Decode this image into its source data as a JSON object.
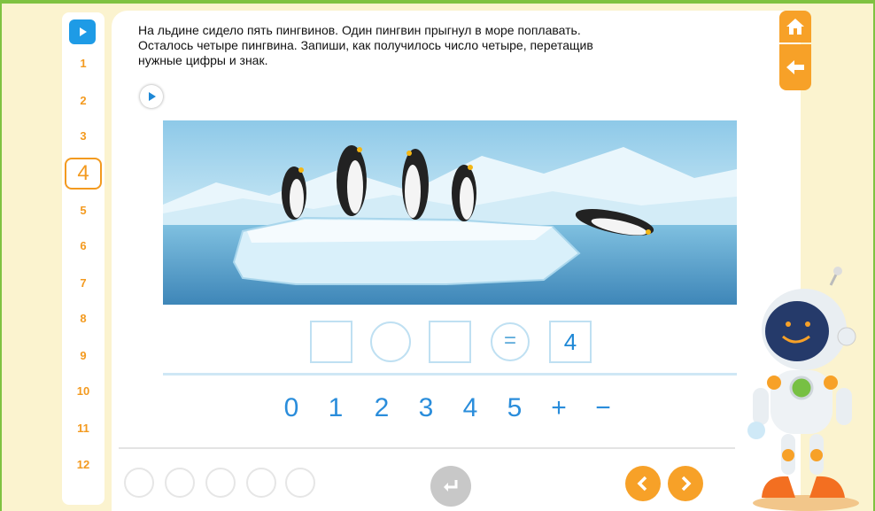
{
  "sidebar": {
    "numbers": [
      "1",
      "2",
      "3",
      "4",
      "5",
      "6",
      "7",
      "8",
      "9",
      "10",
      "11",
      "12"
    ],
    "active": "4"
  },
  "task": {
    "text_line1": "На льдине сидело пять пингвинов. Один пингвин прыгнул в море поплавать.",
    "text_line2": "Осталось четыре пингвина. Запиши, как получилось число четыре, перетащив",
    "text_line3": "нужные цифры и знак."
  },
  "equation": {
    "equals": "=",
    "result": "4"
  },
  "choices": [
    "0",
    "1",
    "2",
    "3",
    "4",
    "5",
    "+",
    "−"
  ],
  "colors": {
    "accent_orange": "#f7a128",
    "accent_blue": "#1e9be6",
    "frame_green": "#7fc241",
    "digit_blue": "#2a8ddb"
  },
  "icons": {
    "home": "home-icon",
    "back": "back-arrow-icon",
    "play": "play-icon",
    "enter": "enter-icon",
    "prev": "chevron-left-icon",
    "next": "chevron-right-icon"
  }
}
